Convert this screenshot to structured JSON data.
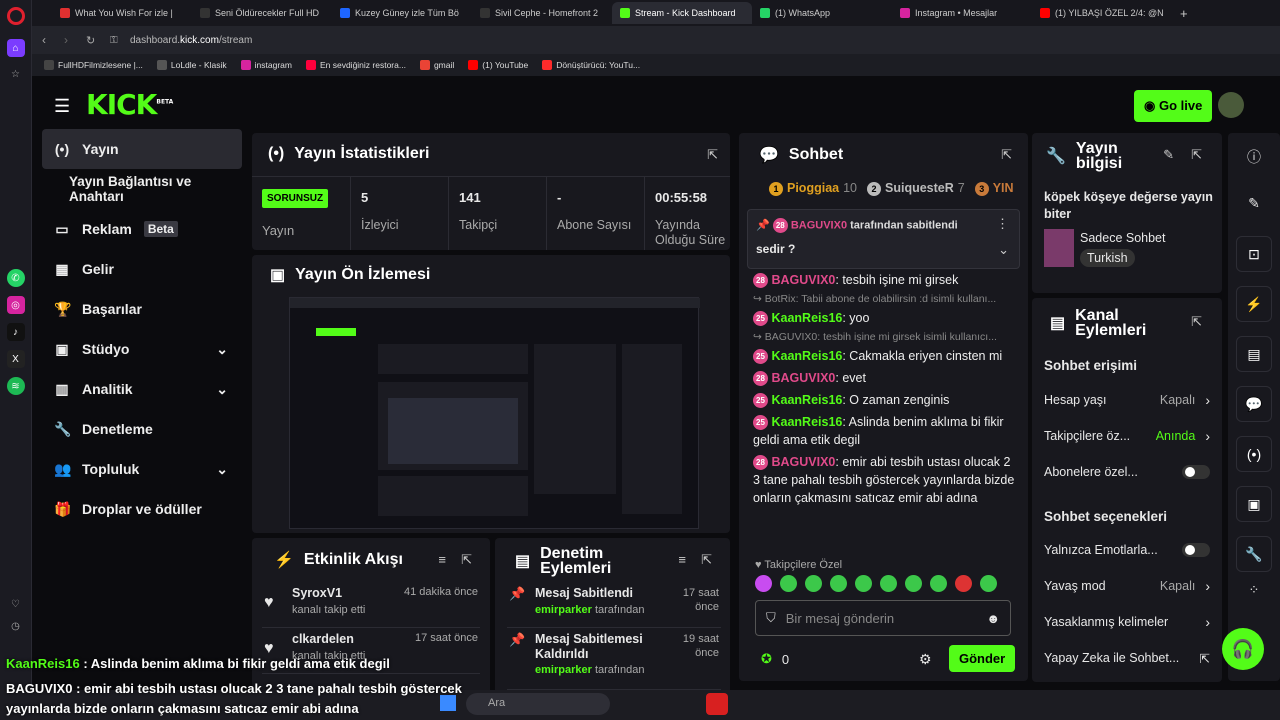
{
  "browser": {
    "tabs": [
      {
        "label": "What You Wish For izle |",
        "color": "#e03030"
      },
      {
        "label": "Seni Öldürecekler Full HD",
        "color": "#333"
      },
      {
        "label": "Kuzey Güney izle Tüm Bö",
        "color": "#1e66ff"
      },
      {
        "label": "Sivil Cephe - Homefront 2",
        "color": "#333"
      },
      {
        "label": "Stream - Kick Dashboard",
        "color": "#53fc18"
      },
      {
        "label": "(1) WhatsApp",
        "color": "#25d366"
      },
      {
        "label": "Instagram • Mesajlar",
        "color": "#d6249f"
      },
      {
        "label": "(1) YILBAŞI ÖZEL 2/4: @N",
        "color": "#ff0000"
      }
    ],
    "url_host": "dashboard.",
    "url_domain": "kick.com",
    "url_path": "/stream",
    "bookmarks": [
      {
        "label": "FullHDFilmizlesene |...",
        "color": "#444"
      },
      {
        "label": "LoLdle - Klasik",
        "color": "#555"
      },
      {
        "label": "instagram",
        "color": "#d6249f"
      },
      {
        "label": "En sevdiğiniz restora...",
        "color": "#ff003c"
      },
      {
        "label": "gmail",
        "color": "#ea4335"
      },
      {
        "label": "(1) YouTube",
        "color": "#ff0000"
      },
      {
        "label": "Dönüştürücü: YouTu...",
        "color": "#ff2b2b"
      }
    ]
  },
  "header": {
    "logo": "KICK",
    "logo_beta": "BETA",
    "go_live": "Go live"
  },
  "nav": {
    "items": [
      {
        "label": "Yayın",
        "icon": "(•)"
      },
      {
        "label": "Yayın Bağlantısı ve Anahtarı",
        "icon": ""
      },
      {
        "label": "Reklam",
        "icon": "▭",
        "badge": "Beta"
      },
      {
        "label": "Gelir",
        "icon": "▦"
      },
      {
        "label": "Başarılar",
        "icon": "🏆"
      },
      {
        "label": "Stüdyo",
        "icon": "▣",
        "chevron": "⌄"
      },
      {
        "label": "Analitik",
        "icon": "▥",
        "chevron": "⌄"
      },
      {
        "label": "Denetleme",
        "icon": "🔧"
      },
      {
        "label": "Topluluk",
        "icon": "👥",
        "chevron": "⌄"
      },
      {
        "label": "Droplar ve ödüller",
        "icon": "🎁"
      }
    ]
  },
  "stats": {
    "title": "Yayın İstatistikleri",
    "status": "SORUNSUZ",
    "status_label": "Yayın",
    "cells": [
      {
        "value": "5",
        "label": "İzleyici"
      },
      {
        "value": "141",
        "label": "Takipçi"
      },
      {
        "value": "-",
        "label": "Abone Sayısı"
      },
      {
        "value": "00:55:58",
        "label": "Yayında Olduğu Süre"
      }
    ]
  },
  "preview": {
    "title": "Yayın Ön İzlemesi"
  },
  "activity": {
    "title": "Etkinlik Akışı",
    "items": [
      {
        "user": "SyroxV1",
        "action": "kanalı takip etti",
        "time": "41 dakika önce"
      },
      {
        "user": "clkardelen",
        "action": "kanalı takip etti",
        "time": "17 saat önce"
      }
    ]
  },
  "moderation": {
    "title": "Denetim Eylemleri",
    "items": [
      {
        "action": "Mesaj Sabitlendi",
        "by": "emirparker",
        "by_suffix": "tarafından",
        "time": "17 saat önce"
      },
      {
        "action": "Mesaj Sabitlemesi Kaldırıldı",
        "by": "emirparker",
        "by_suffix": "tarafından",
        "time": "19 saat önce"
      }
    ]
  },
  "chat": {
    "title": "Sohbet",
    "leaders": [
      {
        "rank": "1",
        "name": "Pioggiaa",
        "count": "10"
      },
      {
        "rank": "2",
        "name": "SuiquesteR",
        "count": "7"
      },
      {
        "rank": "3",
        "name": "YIN",
        "count": ""
      }
    ],
    "pinned_by": "BAGUVIX0",
    "pinned_suffix": "tarafından sabitlendi",
    "pinned_text": "sedir ?",
    "messages": [
      {
        "type": "msg",
        "user": "BAGUVIX0",
        "color": "#e04a8a",
        "badge": "28",
        "text": ": tesbih işine mi girsek"
      },
      {
        "type": "reply",
        "text": "↪ BotRix: Tabii abone de olabilirsin :d isimli kullanı..."
      },
      {
        "type": "msg",
        "user": "KaanReis16",
        "color": "#53fc18",
        "badge": "25",
        "text": ": yoo"
      },
      {
        "type": "reply",
        "text": "↪ BAGUVIX0: tesbih işine mi girsek isimli kullanıcı..."
      },
      {
        "type": "msg",
        "user": "KaanReis16",
        "color": "#53fc18",
        "badge": "25",
        "text": ": Cakmakla eriyen cinsten mi"
      },
      {
        "type": "msg",
        "user": "BAGUVIX0",
        "color": "#e04a8a",
        "badge": "28",
        "text": ": evet"
      },
      {
        "type": "msg",
        "user": "KaanReis16",
        "color": "#53fc18",
        "badge": "25",
        "text": ": O zaman zenginis"
      },
      {
        "type": "msg",
        "user": "KaanReis16",
        "color": "#53fc18",
        "badge": "25",
        "text": ": Aslinda benim aklıma bi fikir geldi ama etik degil"
      },
      {
        "type": "msg",
        "user": "BAGUVIX0",
        "color": "#e04a8a",
        "badge": "28",
        "text": ": emir abi tesbih ustası olucak 2 3 tane pahalı tesbih göstercek yayınlarda bizde onların çakmasını satıcaz emir abi adına"
      }
    ],
    "followers_only": "♥ Takipçilere Özel",
    "input_placeholder": "Bir mesaj gönderin",
    "points": "0",
    "send": "Gönder"
  },
  "info": {
    "title": "Yayın bilgisi",
    "stream_title": "köpek köşeye değerse yayın biter",
    "category": "Sadece Sohbet",
    "language": "Turkish"
  },
  "channel": {
    "title": "Kanal Eylemleri",
    "section1": "Sohbet erişimi",
    "rows1": [
      {
        "label": "Hesap yaşı",
        "value": "Kapalı",
        "kind": "chev"
      },
      {
        "label": "Takipçilere öz...",
        "value": "Anında",
        "kind": "chev",
        "green": true
      },
      {
        "label": "Abonelere özel...",
        "value": "",
        "kind": "switch"
      }
    ],
    "section2": "Sohbet seçenekleri",
    "rows2": [
      {
        "label": "Yalnızca Emotlarla...",
        "value": "",
        "kind": "switch"
      },
      {
        "label": "Yavaş mod",
        "value": "Kapalı",
        "kind": "chev"
      },
      {
        "label": "Yasaklanmış kelimeler",
        "value": "",
        "kind": "chev"
      },
      {
        "label": "Yapay Zeka ile Sohbet...",
        "value": "",
        "kind": "ext"
      }
    ]
  },
  "overlay": {
    "line1_user": "KaanReis16",
    "line1_text": " : Aslinda benim aklıma bi fikir geldi ama etik degil",
    "line2_user": "BAGUVIX0",
    "line2_text": " : emir abi tesbih ustası olucak 2 3 tane pahalı tesbih göstercek",
    "line3_text": "yayınlarda bizde onların çakmasını satıcaz emir abi adına"
  },
  "taskbar": {
    "search": "Ara"
  },
  "colors": {
    "accent": "#53fc18",
    "panel": "#18181e",
    "bg": "#0b0b0e"
  }
}
